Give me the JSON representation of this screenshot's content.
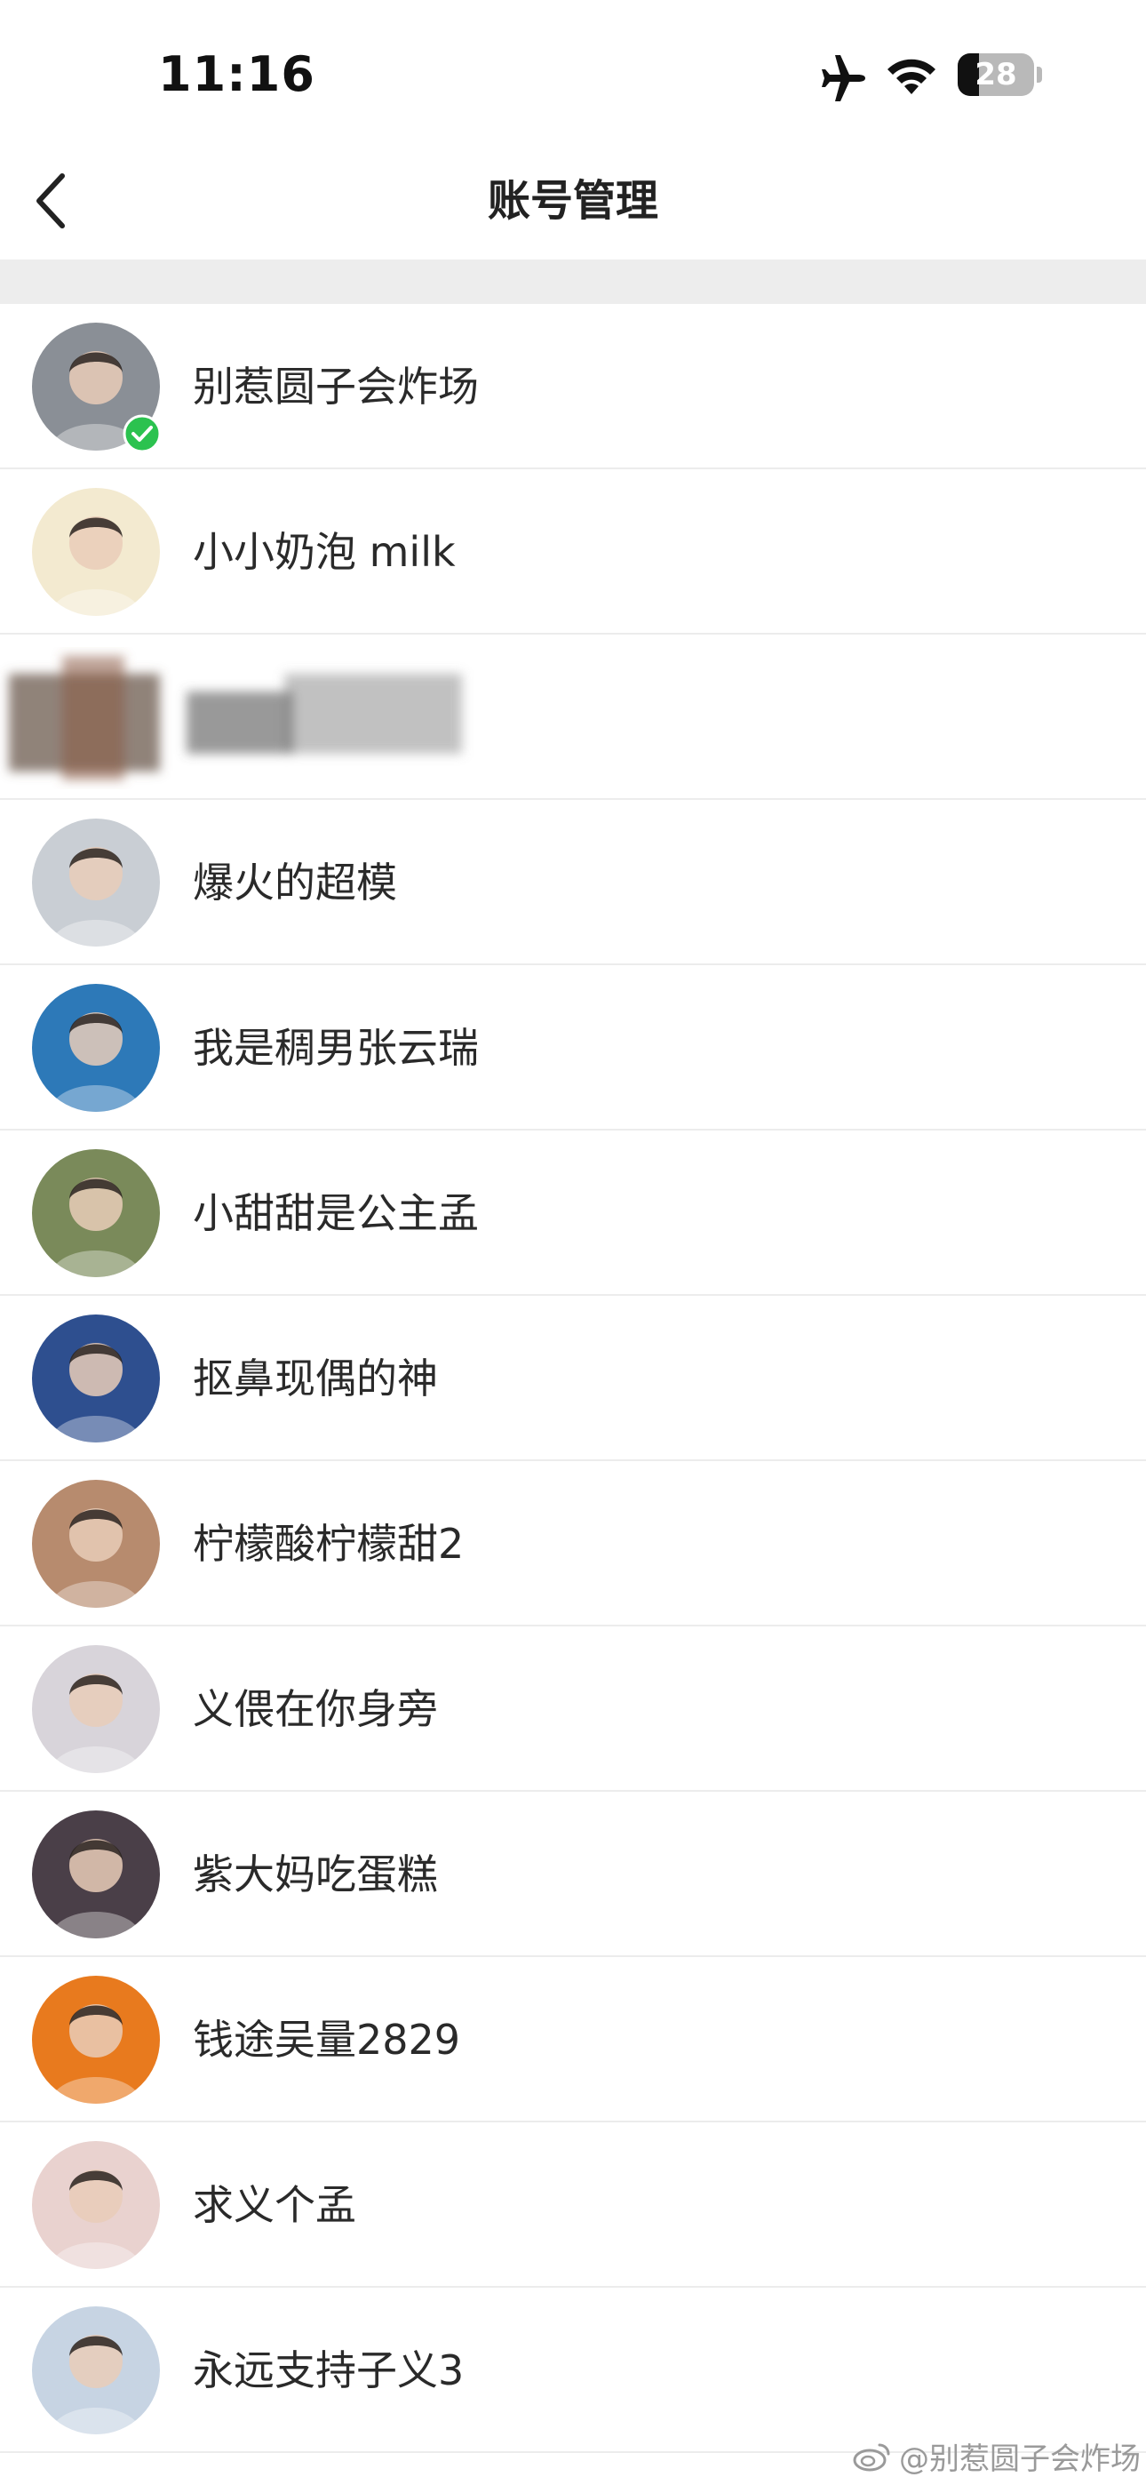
{
  "status_bar": {
    "time": "11:16",
    "battery_level": "28",
    "battery_fraction": 0.28,
    "icons": [
      "airplane-icon",
      "wifi-icon",
      "battery-icon"
    ]
  },
  "nav": {
    "title": "账号管理",
    "back_icon": "chevron-left-icon"
  },
  "accounts": [
    {
      "name": "别惹圆子会炸场",
      "current": true,
      "avatar_color": "#8a8f96"
    },
    {
      "name": "小小奶泡 milk",
      "current": false,
      "avatar_color": "#f3ead0"
    },
    {
      "name": "",
      "current": false,
      "redacted": true,
      "avatar_color": "#6b5a4e"
    },
    {
      "name": "爆火的超模",
      "current": false,
      "avatar_color": "#c9ced4"
    },
    {
      "name": "我是稠男张云瑞",
      "current": false,
      "avatar_color": "#2d79b8"
    },
    {
      "name": "小甜甜是公主孟",
      "current": false,
      "avatar_color": "#7a8a5a"
    },
    {
      "name": "抠鼻现偶的神",
      "current": false,
      "avatar_color": "#2e4f8f"
    },
    {
      "name": "柠檬酸柠檬甜2",
      "current": false,
      "avatar_color": "#b78b6e"
    },
    {
      "name": "义偎在你身旁",
      "current": false,
      "avatar_color": "#d8d4da"
    },
    {
      "name": "紫大妈吃蛋糕",
      "current": false,
      "avatar_color": "#4a3f48"
    },
    {
      "name": "钱途吴量2829",
      "current": false,
      "avatar_color": "#e87a1e"
    },
    {
      "name": "求义个孟",
      "current": false,
      "avatar_color": "#e9d2cf"
    },
    {
      "name": "永远支持子义3",
      "current": false,
      "avatar_color": "#c7d4e3"
    }
  ],
  "watermark": "@别惹圆子会炸场",
  "colors": {
    "verified_green": "#2bc24f",
    "separator": "#ededed",
    "divider": "#ececec"
  }
}
